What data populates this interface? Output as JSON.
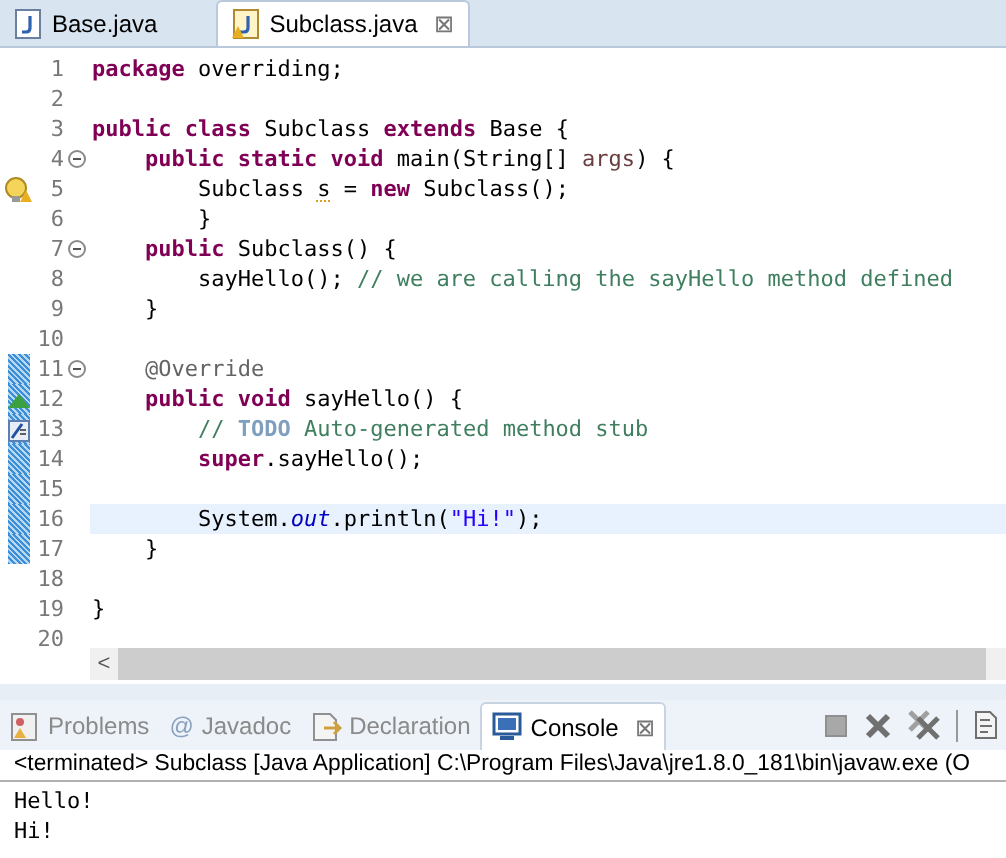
{
  "editor_tabs": [
    {
      "label": "Base.java",
      "selected": false,
      "warning": false
    },
    {
      "label": "Subclass.java",
      "selected": true,
      "warning": true,
      "close": "⊠"
    }
  ],
  "code_lines": [
    {
      "number": "1",
      "fold": false,
      "changed": false,
      "current": false,
      "warning": false,
      "override": false,
      "task": false,
      "tokens": [
        {
          "kind": "keyword",
          "text": "package"
        },
        {
          "kind": "plain",
          "text": " overriding;"
        }
      ]
    },
    {
      "number": "2",
      "fold": false,
      "changed": false,
      "current": false,
      "warning": false,
      "override": false,
      "task": false
    },
    {
      "number": "3",
      "fold": false,
      "changed": false,
      "current": false,
      "warning": false,
      "override": false,
      "task": false,
      "tokens": [
        {
          "kind": "keyword",
          "text": "public"
        },
        {
          "kind": "keyword",
          "text": " class"
        },
        {
          "kind": "plain",
          "text": " Subclass"
        },
        {
          "kind": "keyword",
          "text": " extends"
        },
        {
          "kind": "plain",
          "text": " Base {"
        }
      ]
    },
    {
      "number": "4",
      "fold": true,
      "changed": false,
      "current": false,
      "warning": false,
      "override": false,
      "task": false,
      "tokens": [
        {
          "kind": "keyword",
          "text": "    public"
        },
        {
          "kind": "keyword",
          "text": " static"
        },
        {
          "kind": "keyword",
          "text": " void"
        },
        {
          "kind": "plain",
          "text": " main(String[]"
        },
        {
          "kind": "variable",
          "text": " args"
        },
        {
          "kind": "plain",
          "text": ") {"
        }
      ]
    },
    {
      "number": "5",
      "fold": false,
      "changed": false,
      "current": false,
      "warning": true,
      "override": false,
      "task": false,
      "tokens": [
        {
          "kind": "plain",
          "text": "        Subclass "
        },
        {
          "kind": "warning",
          "text": "s"
        },
        {
          "kind": "plain",
          "text": " ="
        },
        {
          "kind": "keyword",
          "text": " new"
        },
        {
          "kind": "plain",
          "text": " Subclass();"
        }
      ]
    },
    {
      "number": "6",
      "fold": false,
      "changed": false,
      "current": false,
      "warning": false,
      "override": false,
      "task": false,
      "tokens": [
        {
          "kind": "plain",
          "text": "        }"
        }
      ]
    },
    {
      "number": "7",
      "fold": true,
      "changed": false,
      "current": false,
      "warning": false,
      "override": false,
      "task": false,
      "tokens": [
        {
          "kind": "keyword",
          "text": "    public"
        },
        {
          "kind": "plain",
          "text": " Subclass() {"
        }
      ]
    },
    {
      "number": "8",
      "fold": false,
      "changed": false,
      "current": false,
      "warning": false,
      "override": false,
      "task": false,
      "tokens": [
        {
          "kind": "plain",
          "text": "        sayHello(); "
        },
        {
          "kind": "comment",
          "text": "// we are calling the sayHello method defined"
        }
      ]
    },
    {
      "number": "9",
      "fold": false,
      "changed": false,
      "current": false,
      "warning": false,
      "override": false,
      "task": false,
      "tokens": [
        {
          "kind": "plain",
          "text": "    }"
        }
      ]
    },
    {
      "number": "10",
      "fold": false,
      "changed": false,
      "current": false,
      "warning": false,
      "override": false,
      "task": false
    },
    {
      "number": "11",
      "fold": true,
      "changed": true,
      "current": false,
      "warning": false,
      "override": false,
      "task": false,
      "tokens": [
        {
          "kind": "annotation",
          "text": "    @Override"
        }
      ]
    },
    {
      "number": "12",
      "fold": false,
      "changed": true,
      "current": false,
      "warning": false,
      "override": true,
      "task": false,
      "tokens": [
        {
          "kind": "keyword",
          "text": "    public"
        },
        {
          "kind": "keyword",
          "text": " void"
        },
        {
          "kind": "plain",
          "text": " sayHello() {"
        }
      ]
    },
    {
      "number": "13",
      "fold": false,
      "changed": true,
      "current": false,
      "warning": false,
      "override": false,
      "task": true,
      "tokens": [
        {
          "kind": "comment",
          "text": "        // "
        },
        {
          "kind": "todo",
          "text": "TODO"
        },
        {
          "kind": "comment",
          "text": " Auto-generated method stub"
        }
      ]
    },
    {
      "number": "14",
      "fold": false,
      "changed": true,
      "current": false,
      "warning": false,
      "override": false,
      "task": false,
      "tokens": [
        {
          "kind": "keyword",
          "text": "        super"
        },
        {
          "kind": "plain",
          "text": ".sayHello();"
        }
      ]
    },
    {
      "number": "15",
      "fold": false,
      "changed": true,
      "current": false,
      "warning": false,
      "override": false,
      "task": false
    },
    {
      "number": "16",
      "fold": false,
      "changed": true,
      "current": true,
      "warning": false,
      "override": false,
      "task": false,
      "tokens": [
        {
          "kind": "plain",
          "text": "        System."
        },
        {
          "kind": "field",
          "text": "out"
        },
        {
          "kind": "plain",
          "text": ".println("
        },
        {
          "kind": "string",
          "text": "\"Hi!\""
        },
        {
          "kind": "plain",
          "text": ");"
        }
      ]
    },
    {
      "number": "17",
      "fold": false,
      "changed": true,
      "current": false,
      "warning": false,
      "override": false,
      "task": false,
      "tokens": [
        {
          "kind": "plain",
          "text": "    }"
        }
      ]
    },
    {
      "number": "18",
      "fold": false,
      "changed": false,
      "current": false,
      "warning": false,
      "override": false,
      "task": false
    },
    {
      "number": "19",
      "fold": false,
      "changed": false,
      "current": false,
      "warning": false,
      "override": false,
      "task": false,
      "tokens": [
        {
          "kind": "plain",
          "text": "}"
        }
      ]
    },
    {
      "number": "20",
      "fold": false,
      "changed": false,
      "current": false,
      "warning": false,
      "override": false,
      "task": false
    }
  ],
  "scrollbar": {
    "arrow": "<"
  },
  "view_tabs": [
    {
      "label": "Problems",
      "selected": false
    },
    {
      "label": "Javadoc",
      "icon_text": "@",
      "selected": false
    },
    {
      "label": "Declaration",
      "selected": false
    },
    {
      "label": "Console",
      "selected": true,
      "close": "⊠"
    }
  ],
  "console": {
    "header": "<terminated> Subclass [Java Application] C:\\Program Files\\Java\\jre1.8.0_181\\bin\\javaw.exe (O",
    "output": [
      "Hello!",
      "Hi!"
    ]
  }
}
